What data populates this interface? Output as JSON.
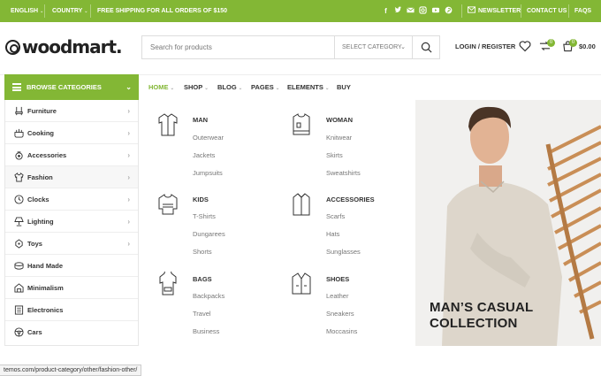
{
  "topbar": {
    "language": "ENGLISH",
    "country": "COUNTRY",
    "shipping": "FREE SHIPPING FOR ALL ORDERS OF $150",
    "social": [
      "facebook-icon",
      "twitter-icon",
      "email-icon",
      "instagram-icon",
      "youtube-icon",
      "pinterest-icon"
    ],
    "newsletter": "NEWSLETTER",
    "contact": "CONTACT US",
    "faqs": "FAQS"
  },
  "header": {
    "logo": "woodmart.",
    "search_placeholder": "Search for products",
    "category_select": "SELECT CATEGORY",
    "login": "LOGIN / REGISTER",
    "compare_count": "0",
    "cart_count": "0",
    "cart_total": "$0.00"
  },
  "browse": {
    "label": "BROWSE CATEGORIES"
  },
  "nav": [
    {
      "label": "HOME",
      "active": true
    },
    {
      "label": "SHOP"
    },
    {
      "label": "BLOG"
    },
    {
      "label": "PAGES"
    },
    {
      "label": "ELEMENTS"
    },
    {
      "label": "BUY"
    }
  ],
  "sidebar": [
    {
      "label": "Furniture",
      "icon": "chair-icon",
      "arrow": true
    },
    {
      "label": "Cooking",
      "icon": "cooking-pot-icon",
      "arrow": true
    },
    {
      "label": "Accessories",
      "icon": "accessories-icon",
      "arrow": true
    },
    {
      "label": "Fashion",
      "icon": "shirt-icon",
      "arrow": true
    },
    {
      "label": "Clocks",
      "icon": "clock-icon",
      "arrow": true
    },
    {
      "label": "Lighting",
      "icon": "lamp-icon",
      "arrow": true
    },
    {
      "label": "Toys",
      "icon": "toy-icon",
      "arrow": true
    },
    {
      "label": "Hand Made",
      "icon": "handmade-icon",
      "arrow": false
    },
    {
      "label": "Minimalism",
      "icon": "minimalism-icon",
      "arrow": false
    },
    {
      "label": "Electronics",
      "icon": "electronics-icon",
      "arrow": false
    },
    {
      "label": "Cars",
      "icon": "car-icon",
      "arrow": false
    }
  ],
  "mega": {
    "columns": [
      {
        "title": "MAN",
        "icon": "man-shirt-icon",
        "links": [
          "Outerwear",
          "Jackets",
          "Jumpsuits"
        ]
      },
      {
        "title": "WOMAN",
        "icon": "woman-shirt-icon",
        "links": [
          "Knitwear",
          "Skirts",
          "Sweatshirts"
        ]
      },
      {
        "title": "KIDS",
        "icon": "kids-sweater-icon",
        "links": [
          "T-Shirts",
          "Dungarees",
          "Shorts"
        ]
      },
      {
        "title": "ACCESSORIES",
        "icon": "accessories-shirt-icon",
        "links": [
          "Scarfs",
          "Hats",
          "Sunglasses"
        ]
      },
      {
        "title": "BAGS",
        "icon": "hoodie-icon",
        "links": [
          "Backpacks",
          "Travel",
          "Business"
        ]
      },
      {
        "title": "SHOES",
        "icon": "jacket-icon",
        "links": [
          "Leather",
          "Sneakers",
          "Moccasins"
        ]
      }
    ]
  },
  "banner": {
    "line1": "MAN’S CASUAL",
    "line2": "COLLECTION"
  },
  "status": {
    "url": "temos.com/product-category/other/fashion-other/"
  },
  "colors": {
    "accent": "#83b735"
  }
}
